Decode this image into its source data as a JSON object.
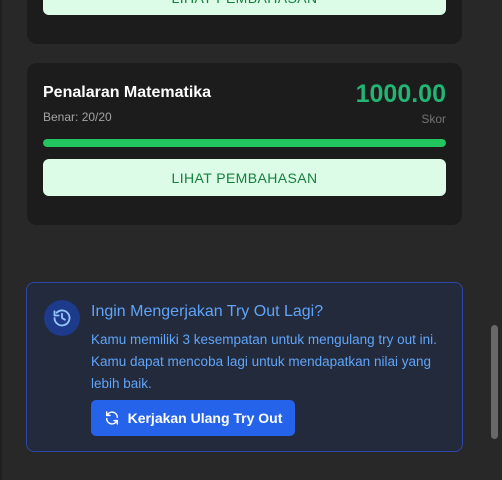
{
  "previous_card": {
    "review_label": "LIHAT PEMBAHASAN"
  },
  "subject_card": {
    "title": "Penalaran Matematika",
    "correct_label": "Benar: 20/20",
    "score": "1000.00",
    "score_label": "Skor",
    "progress_percent": 100,
    "review_label": "LIHAT PEMBAHASAN"
  },
  "retry": {
    "title": "Ingin Mengerjakan Try Out Lagi?",
    "description": "Kamu memiliki 3 kesempatan untuk mengulang try out ini. Kamu dapat mencoba lagi untuk mendapatkan nilai yang lebih baik.",
    "button_label": "Kerjakan Ulang Try Out",
    "icon": "history-icon",
    "button_icon": "refresh-icon"
  },
  "colors": {
    "background": "#282828",
    "card": "#1c1c1c",
    "success": "#22c55e",
    "score": "#22b573",
    "review_button_bg": "#dcfce7",
    "review_button_text": "#15803d",
    "info_text": "#60a5fa",
    "primary_button": "#2563eb"
  }
}
